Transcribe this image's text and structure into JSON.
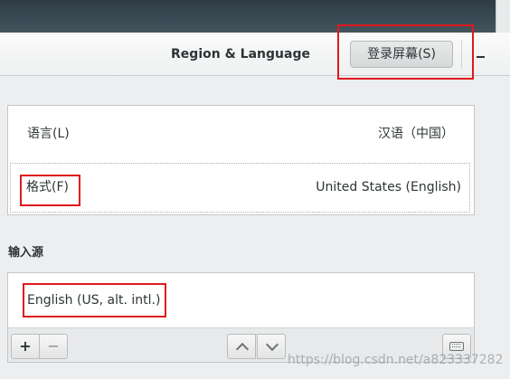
{
  "header": {
    "title": "Region & Language",
    "login_screen_button": "登录屏幕(S)"
  },
  "panel": {
    "rows": [
      {
        "label": "语言(L)",
        "value": "汉语（中国）"
      },
      {
        "label": "格式(F)",
        "value": "United States (English)"
      }
    ]
  },
  "input_sources": {
    "heading": "输入源",
    "items": [
      {
        "label": "English (US, alt. intl.)"
      }
    ],
    "toolbar": {
      "add_icon": "plus",
      "remove_icon": "minus",
      "up_icon": "chevron-up",
      "down_icon": "chevron-down",
      "keyboard_icon": "keyboard",
      "add_label": "+",
      "remove_label": "−"
    }
  },
  "annotations": {
    "highlight_color": "#e0191d"
  },
  "watermark": "https://blog.csdn.net/a823337282"
}
